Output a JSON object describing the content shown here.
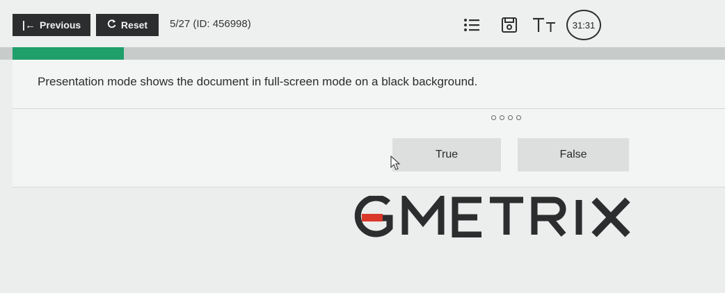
{
  "toolbar": {
    "previous_label": "Previous",
    "previous_glyph": "|←",
    "reset_label": "Reset",
    "reset_glyph": "C",
    "question_counter": "5/27 (ID: 456998)",
    "timer": "31:31",
    "icons": [
      "list-icon",
      "save-icon",
      "text-size-icon"
    ]
  },
  "progress": {
    "fraction": 0.156,
    "color": "#1f9f6a"
  },
  "question": {
    "text": "Presentation mode shows the document in full-screen mode on a black background.",
    "answers": [
      {
        "label": "True"
      },
      {
        "label": "False"
      }
    ]
  },
  "logo": {
    "text": "GMETRIX",
    "accent_color": "#d9382a"
  },
  "colors": {
    "button_dark": "#2b2d2e",
    "accent_green": "#1f9f6a",
    "answer_bg": "#dcdfdd"
  }
}
